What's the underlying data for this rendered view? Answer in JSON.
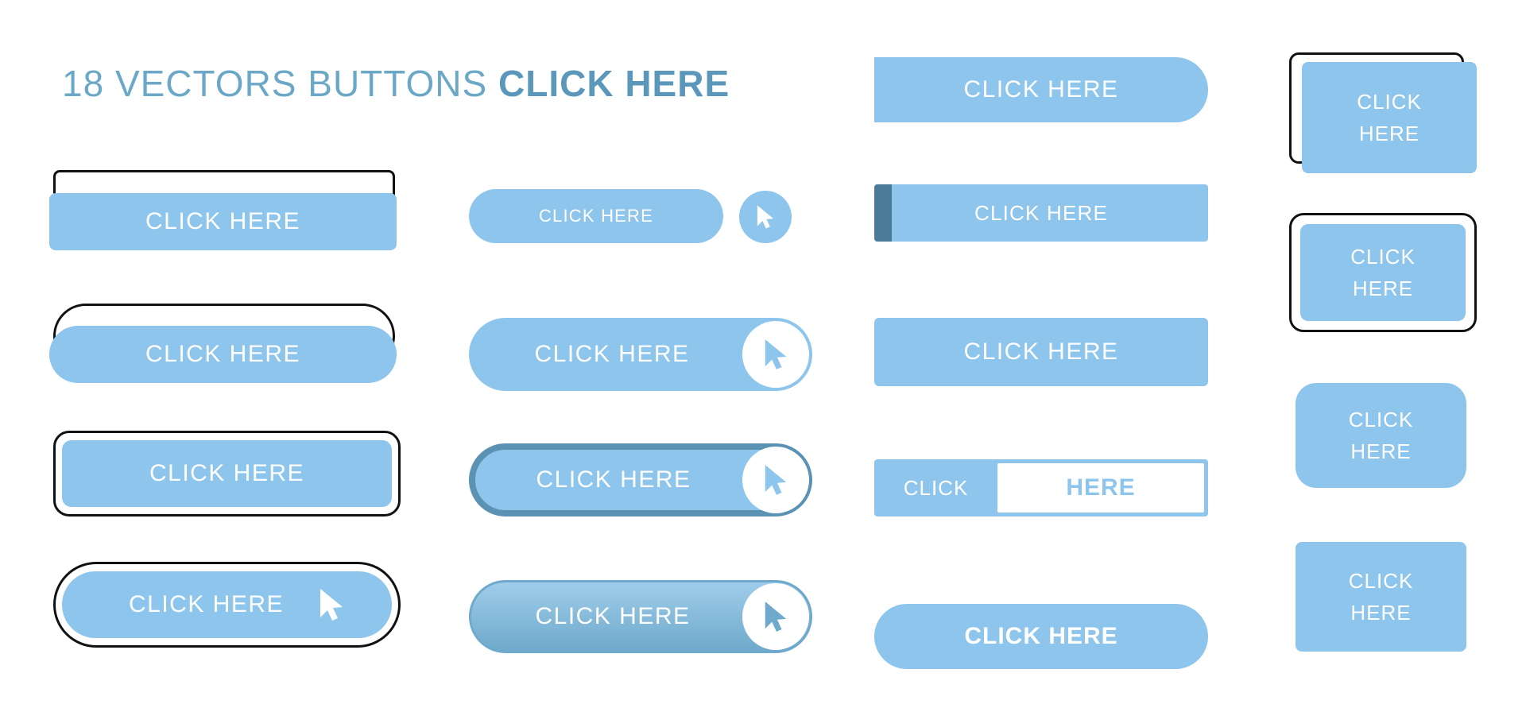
{
  "title": {
    "prefix": "18 VECTORS BUTTONS ",
    "emphasis": "CLICK HERE"
  },
  "colors": {
    "primary": "#8ec5ec",
    "primary_light": "#9ccdf0",
    "outline": "#111111",
    "dark_accent": "#4b7b96",
    "text_on_button": "#ffffff",
    "title_color": "#6ba8c8",
    "background": "#ffffff"
  },
  "icons": {
    "cursor": "cursor-arrow-icon"
  },
  "buttons": [
    {
      "id": "col1-row1",
      "label": "CLICK HERE",
      "style": "rect-offset-outline"
    },
    {
      "id": "col1-row2",
      "label": "CLICK HERE",
      "style": "pill-offset-outline"
    },
    {
      "id": "col1-row3",
      "label": "CLICK HERE",
      "style": "rounded-rect-outline"
    },
    {
      "id": "col1-row4",
      "label": "CLICK HERE",
      "style": "pill-outline-cursor"
    },
    {
      "id": "col2-row1",
      "label": "CLICK HERE",
      "style": "pill-with-separate-cursor-circle"
    },
    {
      "id": "col2-row2",
      "label": "CLICK HERE",
      "style": "pill-with-inset-cursor"
    },
    {
      "id": "col2-row3",
      "label": "CLICK HERE",
      "style": "pill-thick-border-cursor"
    },
    {
      "id": "col2-row4",
      "label": "CLICK HERE",
      "style": "pill-gradient-cursor"
    },
    {
      "id": "col3-row1",
      "label": "CLICK HERE",
      "style": "half-pill-right"
    },
    {
      "id": "col3-row2",
      "label": "CLICK HERE",
      "style": "rect-dark-left-bar"
    },
    {
      "id": "col3-row3",
      "label": "CLICK HERE",
      "style": "rect-plain"
    },
    {
      "id": "col3-row4",
      "label_left": "CLICK",
      "label_right": "HERE",
      "style": "split-two-tone"
    },
    {
      "id": "col3-row5",
      "label": "CLICK HERE",
      "style": "pill-plain"
    },
    {
      "id": "col4-row1",
      "label": "CLICK HERE",
      "style": "small-rect-offset-outline",
      "wrap": true
    },
    {
      "id": "col4-row2",
      "label": "CLICK HERE",
      "style": "small-rounded-outline",
      "wrap": true
    },
    {
      "id": "col4-row3",
      "label": "CLICK HERE",
      "style": "small-rounded-plain",
      "wrap": true
    },
    {
      "id": "col4-row4",
      "label": "CLICK HERE",
      "style": "small-rect-plain",
      "wrap": true
    }
  ]
}
